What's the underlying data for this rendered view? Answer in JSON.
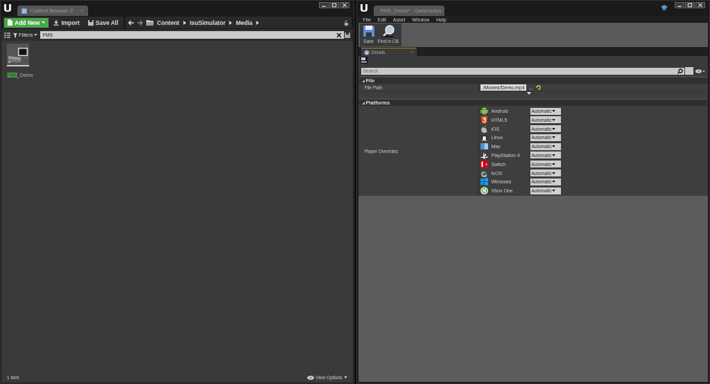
{
  "left_window": {
    "tab": {
      "title": "Content Browser 2"
    },
    "toolbar": {
      "add_new": "Add New",
      "import": "Import",
      "save_all": "Save All"
    },
    "breadcrumbs": [
      "Content",
      "IsuSimulator",
      "Media"
    ],
    "filters": {
      "label": "Filters",
      "search_value": "FMS"
    },
    "assets": [
      {
        "match": "FMS",
        "rest": "_Demo",
        "selected": false
      }
    ],
    "status_bar": {
      "count": "1 item",
      "view_options": "View Options"
    }
  },
  "right_window": {
    "tab": {
      "title": "FMS_Demo* - GenericAss"
    },
    "menu": [
      "File",
      "Edit",
      "Asset",
      "Window",
      "Help"
    ],
    "toolbar": [
      {
        "label": "Save",
        "kind": "save"
      },
      {
        "label": "Find in CB",
        "kind": "find"
      }
    ],
    "details_tab": {
      "title": "Details"
    },
    "search": {
      "placeholder": "Search"
    },
    "sections": [
      {
        "title": "File",
        "rows": [
          {
            "label": "File Path",
            "value": "./Movies/Demo.mp4",
            "browse": "..."
          }
        ]
      },
      {
        "title": "Platforms",
        "label": "Player Overrides",
        "platforms": [
          {
            "name": "Android",
            "kind": "android",
            "value": "Automatic"
          },
          {
            "name": "HTML5",
            "kind": "html5",
            "value": "Automatic"
          },
          {
            "name": "iOS",
            "kind": "apple",
            "value": "Automatic"
          },
          {
            "name": "Linux",
            "kind": "linux",
            "value": "Automatic"
          },
          {
            "name": "Mac",
            "kind": "mac",
            "value": "Automatic"
          },
          {
            "name": "PlayStation 4",
            "kind": "ps",
            "value": "Automatic"
          },
          {
            "name": "Switch",
            "kind": "switch",
            "value": "Automatic"
          },
          {
            "name": "tvOS",
            "kind": "tv",
            "value": "Automatic"
          },
          {
            "name": "Windows",
            "kind": "windows",
            "value": "Automatic"
          },
          {
            "name": "Xbox One",
            "kind": "xbox",
            "value": "Automatic"
          }
        ]
      }
    ]
  }
}
